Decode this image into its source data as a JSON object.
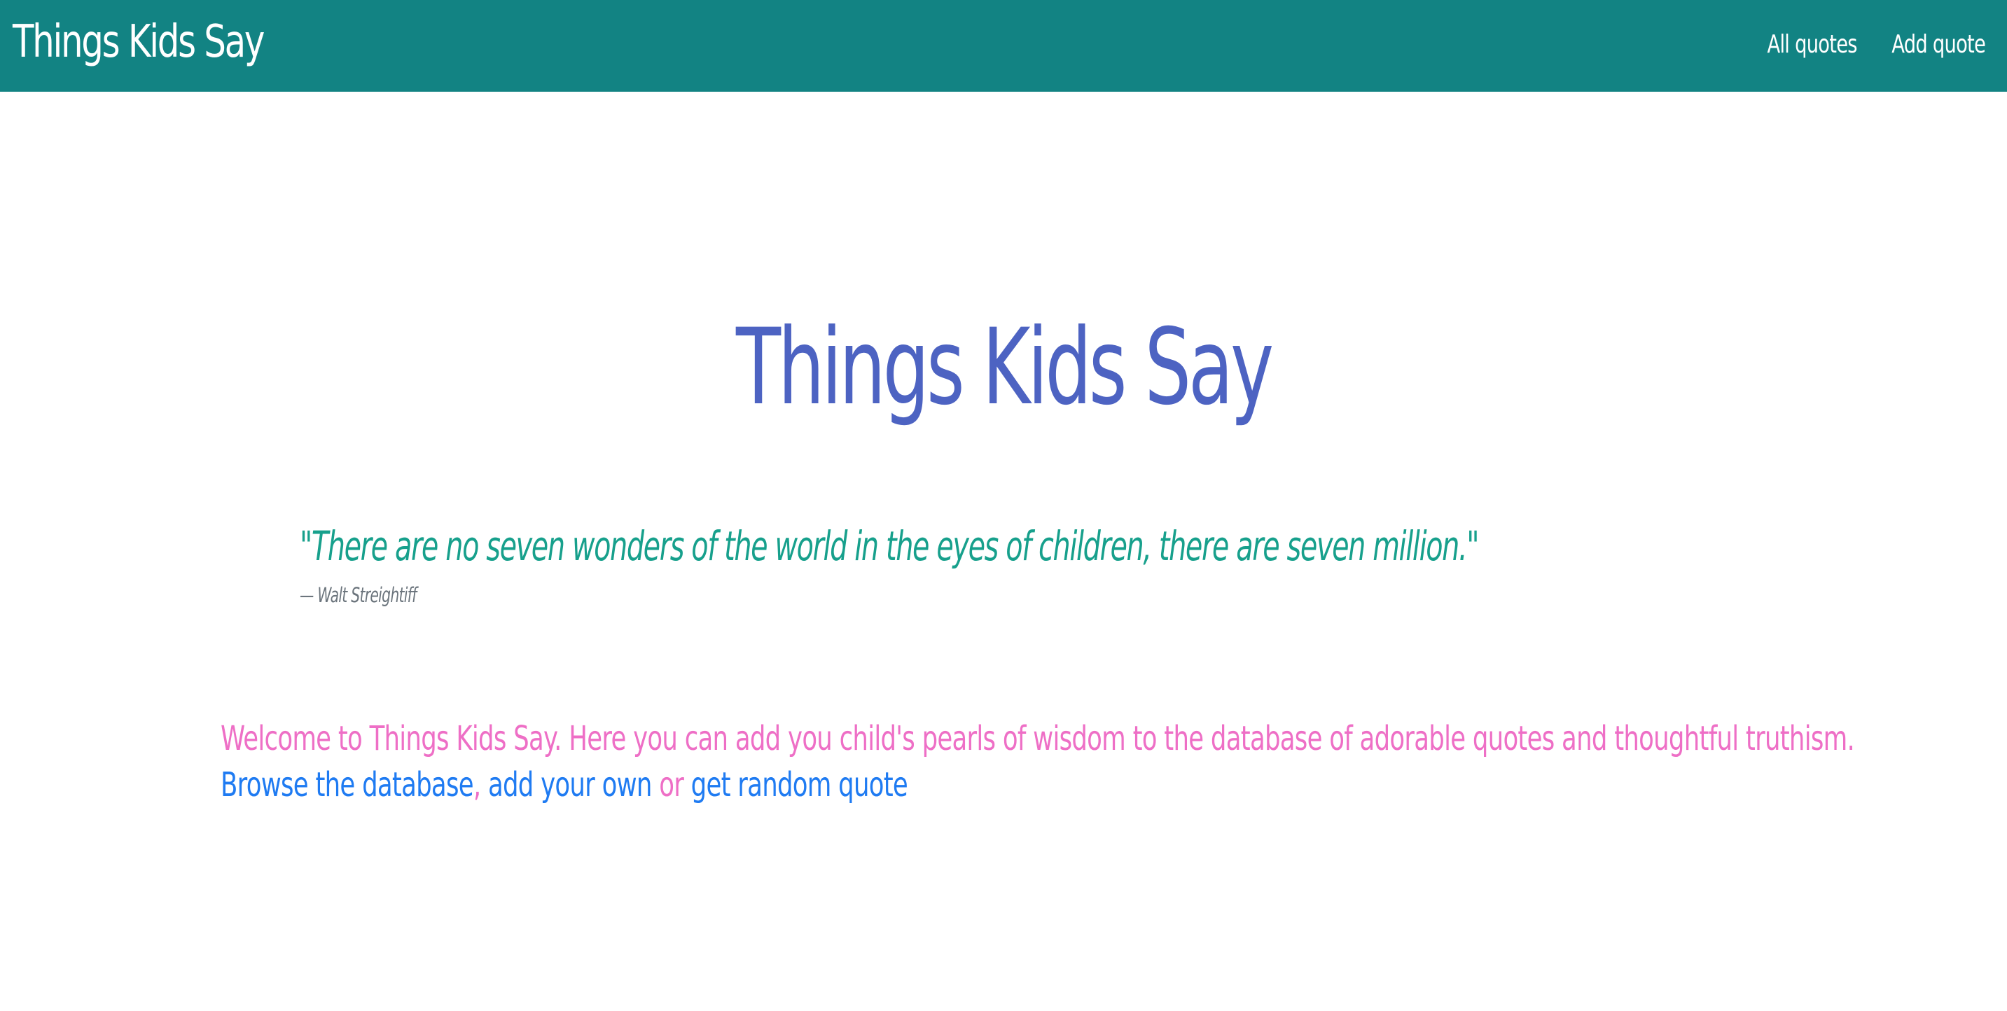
{
  "navbar": {
    "brand": "Things Kids Say",
    "links": [
      {
        "label": "All quotes"
      },
      {
        "label": "Add quote"
      }
    ],
    "background_color": "#128383"
  },
  "hero": {
    "title": "Things Kids Say",
    "title_color": "#4d63c2"
  },
  "featured_quote": {
    "text": "\"There are no seven wonders of the world in the eyes of children, there are seven million.\"",
    "author": "— Walt Streightiff",
    "text_color": "#17a08c"
  },
  "welcome": {
    "intro": "Welcome to Things Kids Say. Here you can add you child's pearls of wisdom to the database of adorable quotes and thoughtful truthism.",
    "browse_link": "Browse the database",
    "separator": ",",
    "add_link": "add your own",
    "or_text": "or",
    "random_link": "get random quote",
    "text_color": "#ee6fc6",
    "link_color": "#1f7bf2"
  }
}
